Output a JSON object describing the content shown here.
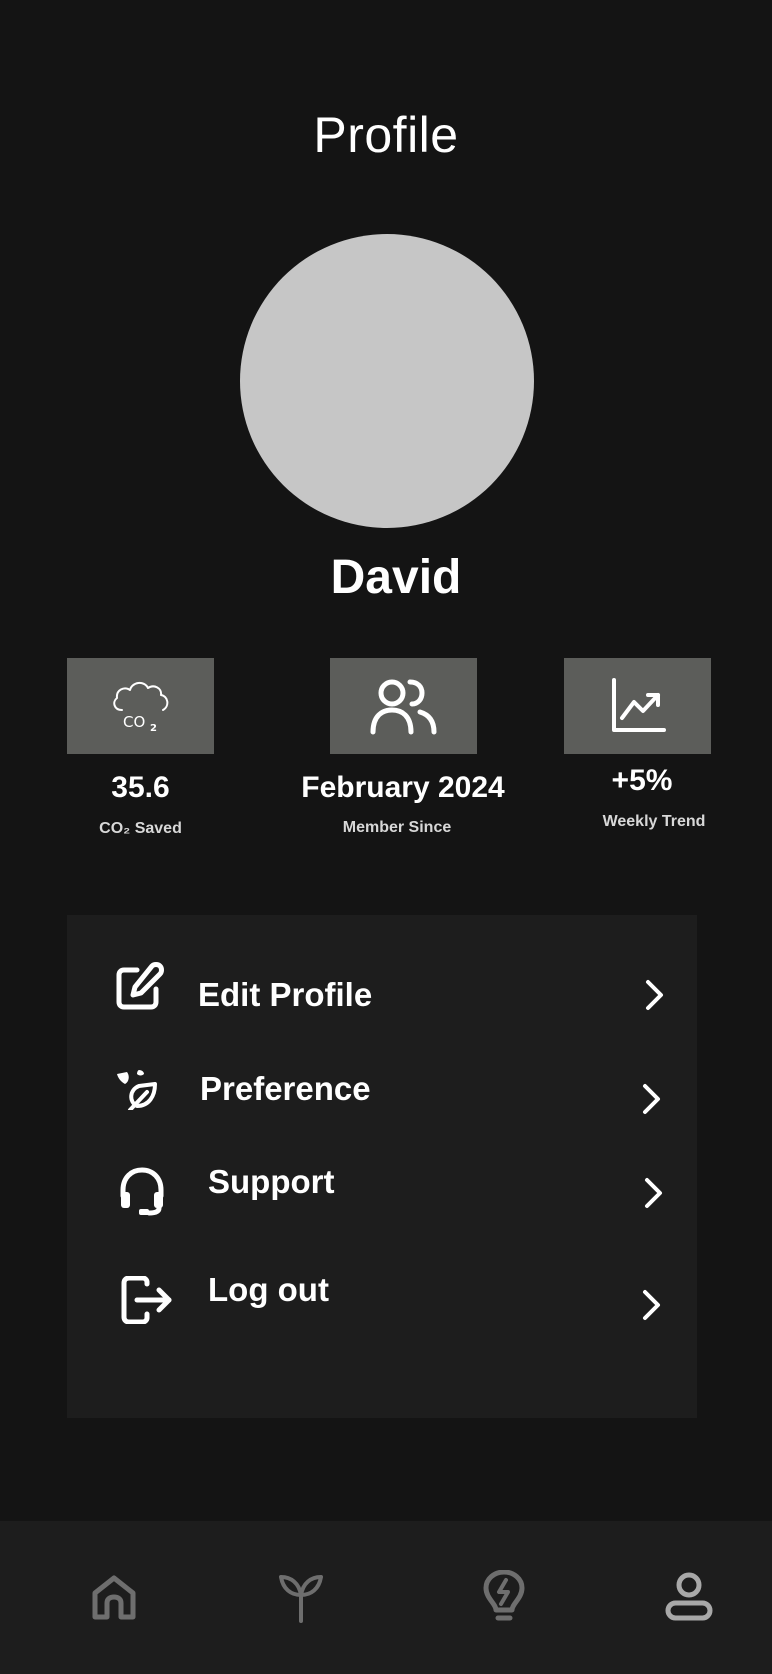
{
  "header": {
    "title": "Profile"
  },
  "profile": {
    "name": "David"
  },
  "stats": [
    {
      "icon": "cloud-co2-icon",
      "value": "35.6",
      "label": "CO₂ Saved"
    },
    {
      "icon": "users-icon",
      "value": "February 2024",
      "label": "Member Since"
    },
    {
      "icon": "trend-chart-icon",
      "value": "+5%",
      "label": "Weekly Trend"
    }
  ],
  "menu": [
    {
      "icon": "edit-icon",
      "label": "Edit Profile"
    },
    {
      "icon": "leaf-icon",
      "label": "Preference"
    },
    {
      "icon": "headset-icon",
      "label": "Support"
    },
    {
      "icon": "logout-icon",
      "label": "Log out"
    }
  ],
  "bottom_nav": [
    {
      "icon": "home-icon"
    },
    {
      "icon": "sprout-icon"
    },
    {
      "icon": "lightbulb-icon"
    },
    {
      "icon": "user-icon",
      "active": true
    }
  ],
  "colors": {
    "background": "#141414",
    "card": "#1d1d1d",
    "stat_box": "#5c5d5a",
    "avatar": "#c6c6c6",
    "nav_icon": "#6e6e6e",
    "nav_icon_active": "#a8a8a8"
  }
}
